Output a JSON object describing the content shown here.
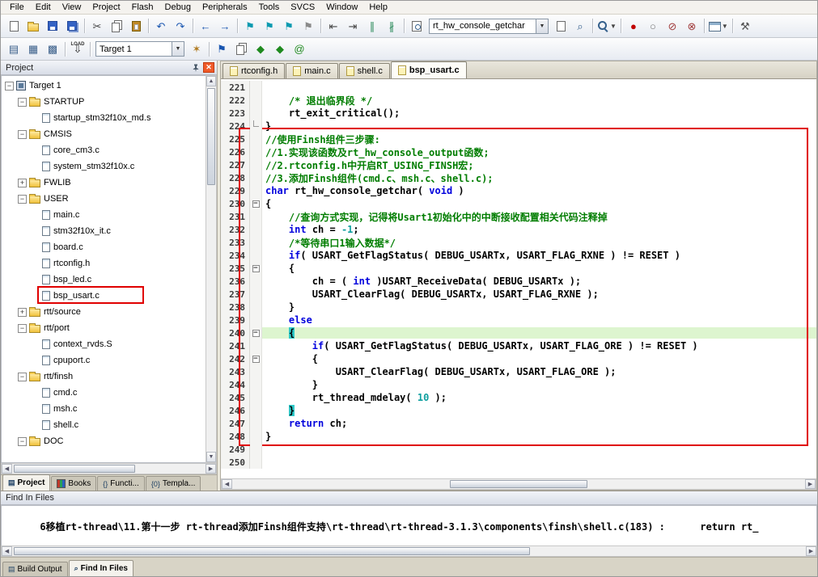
{
  "icons": {
    "dropdown": "▼",
    "minus": "−",
    "plus": "+",
    "fold_minus": "−",
    "scroll_up": "▲",
    "scroll_down": "▼",
    "scroll_left": "◀",
    "scroll_right": "▶"
  },
  "colors": {
    "annotation": "#e00000",
    "keyword": "#0000dd",
    "comment": "#007d00",
    "number": "#0f9f9f",
    "current_line": "#ddf5cf",
    "brace_match": "#2fc9c9"
  },
  "menu": {
    "items": [
      "File",
      "Edit",
      "View",
      "Project",
      "Flash",
      "Debug",
      "Peripherals",
      "Tools",
      "SVCS",
      "Window",
      "Help"
    ]
  },
  "toolbar1": {
    "items": [
      {
        "t": "b",
        "name": "new-file-button",
        "icon": "new-file-icon",
        "css": "pg"
      },
      {
        "t": "b",
        "name": "open-file-button",
        "icon": "open-folder-icon",
        "css": "fld"
      },
      {
        "t": "b",
        "name": "save-button",
        "icon": "save-icon",
        "css": "fl"
      },
      {
        "t": "b",
        "name": "save-all-button",
        "icon": "save-all-icon",
        "css": "fl2"
      },
      {
        "t": "s"
      },
      {
        "t": "b",
        "name": "cut-button",
        "icon": "scissors-icon",
        "glyph": "✂",
        "color": "#444"
      },
      {
        "t": "b",
        "name": "copy-button",
        "icon": "copy-icon",
        "css": "copy"
      },
      {
        "t": "b",
        "name": "paste-button",
        "icon": "paste-icon",
        "css": "paste"
      },
      {
        "t": "s"
      },
      {
        "t": "b",
        "name": "undo-button",
        "icon": "undo-icon",
        "glyph": "↶",
        "color": "#1a56b0"
      },
      {
        "t": "b",
        "name": "redo-button",
        "icon": "redo-icon",
        "glyph": "↷",
        "color": "#1a56b0"
      },
      {
        "t": "s"
      },
      {
        "t": "b",
        "name": "navigate-back-button",
        "icon": "arrow-left-icon",
        "glyph": "←",
        "color": "#1a56b0"
      },
      {
        "t": "b",
        "name": "navigate-forward-button",
        "icon": "arrow-right-icon",
        "glyph": "→",
        "color": "#1a56b0"
      },
      {
        "t": "s"
      },
      {
        "t": "b",
        "name": "toggle-bookmark-button",
        "icon": "bookmark-icon",
        "glyph": "⚑",
        "color": "#0a9ab0"
      },
      {
        "t": "b",
        "name": "prev-bookmark-button",
        "icon": "bookmark-prev-icon",
        "glyph": "⚑",
        "color": "#0a9ab0"
      },
      {
        "t": "b",
        "name": "next-bookmark-button",
        "icon": "bookmark-next-icon",
        "glyph": "⚑",
        "color": "#0a9ab0"
      },
      {
        "t": "b",
        "name": "clear-bookmarks-button",
        "icon": "bookmark-clear-icon",
        "glyph": "⚑",
        "color": "#8a8a8a"
      },
      {
        "t": "s"
      },
      {
        "t": "b",
        "name": "unindent-button",
        "icon": "unindent-icon",
        "glyph": "⇤",
        "color": "#444"
      },
      {
        "t": "b",
        "name": "indent-button",
        "icon": "indent-icon",
        "glyph": "⇥",
        "color": "#444"
      },
      {
        "t": "b",
        "name": "comment-button",
        "icon": "comment-icon",
        "glyph": "∥",
        "color": "#2a8a5a"
      },
      {
        "t": "b",
        "name": "uncomment-button",
        "icon": "uncomment-icon",
        "glyph": "∦",
        "color": "#2a8a5a"
      },
      {
        "t": "s"
      },
      {
        "t": "b",
        "name": "find-in-files-toolbar-button",
        "icon": "page-search-icon",
        "css": "pgm"
      },
      {
        "t": "c",
        "name": "find-text-combo",
        "value": "rt_hw_console_getchar",
        "w": 148
      },
      {
        "t": "b",
        "name": "search-files-button",
        "icon": "page-arrow-icon",
        "css": "pg"
      },
      {
        "t": "b",
        "name": "incremental-find-button",
        "icon": "binoculars-icon",
        "glyph": "⌕",
        "color": "#35608c"
      },
      {
        "t": "s"
      },
      {
        "t": "b",
        "name": "find-button",
        "icon": "magnifier-icon",
        "css": "mag",
        "dd": true
      },
      {
        "t": "s"
      },
      {
        "t": "b",
        "name": "insert-breakpoint-button",
        "icon": "breakpoint-icon",
        "glyph": "●",
        "color": "#c00000"
      },
      {
        "t": "b",
        "name": "enable-breakpoint-button",
        "icon": "breakpoint-enable-icon",
        "glyph": "○",
        "color": "#777777"
      },
      {
        "t": "b",
        "name": "disable-all-breakpoints-button",
        "icon": "breakpoint-disable-icon",
        "glyph": "⊘",
        "color": "#a03a3a"
      },
      {
        "t": "b",
        "name": "kill-all-breakpoints-button",
        "icon": "breakpoint-kill-icon",
        "glyph": "⊗",
        "color": "#a03a3a"
      },
      {
        "t": "s"
      },
      {
        "t": "b",
        "name": "debug-windows-button",
        "icon": "window-layout-icon",
        "css": "win",
        "dd": true
      },
      {
        "t": "s"
      },
      {
        "t": "b",
        "name": "configure-button",
        "icon": "wrench-icon",
        "glyph": "⚒",
        "color": "#555555"
      }
    ]
  },
  "toolbar2": {
    "items": [
      {
        "t": "b",
        "name": "translate-file-button",
        "icon": "translate-icon",
        "glyph": "▤",
        "color": "#3a5f8a"
      },
      {
        "t": "b",
        "name": "build-button",
        "icon": "build-icon",
        "glyph": "▦",
        "color": "#3a5f8a"
      },
      {
        "t": "b",
        "name": "rebuild-all-button",
        "icon": "rebuild-icon",
        "glyph": "▩",
        "color": "#3a5f8a"
      },
      {
        "t": "s"
      },
      {
        "t": "b",
        "name": "download-button",
        "icon": "download-icon",
        "glyph": "⇩",
        "color": "#333333",
        "label": "LOAD"
      },
      {
        "t": "s"
      },
      {
        "t": "c",
        "name": "target-select-combo",
        "value": "Target 1",
        "w": 110
      },
      {
        "t": "b",
        "name": "options-for-target-button",
        "icon": "magic-wand-icon",
        "glyph": "✶",
        "color": "#b07a20"
      },
      {
        "t": "s"
      },
      {
        "t": "b",
        "name": "file-extensions-button",
        "icon": "flag-icon",
        "glyph": "⚑",
        "color": "#1a56b0"
      },
      {
        "t": "b",
        "name": "manage-project-items-button",
        "icon": "stack-icon",
        "css": "copy"
      },
      {
        "t": "b",
        "name": "prev-item-button",
        "icon": "diamond-left-icon",
        "glyph": "◆",
        "color": "#1f8a1f"
      },
      {
        "t": "b",
        "name": "next-item-button",
        "icon": "diamond-right-icon",
        "glyph": "◆",
        "color": "#1f8a1f"
      },
      {
        "t": "b",
        "name": "pack-installer-button",
        "icon": "spiral-icon",
        "glyph": "@",
        "color": "#1f8a1f"
      }
    ]
  },
  "project_panel": {
    "title": "Project",
    "tree": [
      {
        "depth": 0,
        "expander": "minus",
        "icon": "target",
        "label": "Target 1"
      },
      {
        "depth": 1,
        "expander": "minus",
        "icon": "folder",
        "label": "STARTUP"
      },
      {
        "depth": 2,
        "icon": "file",
        "label": "startup_stm32f10x_md.s"
      },
      {
        "depth": 1,
        "expander": "minus",
        "icon": "folder",
        "label": "CMSIS"
      },
      {
        "depth": 2,
        "icon": "file",
        "label": "core_cm3.c"
      },
      {
        "depth": 2,
        "icon": "file",
        "label": "system_stm32f10x.c"
      },
      {
        "depth": 1,
        "expander": "plus",
        "icon": "folder",
        "label": "FWLIB"
      },
      {
        "depth": 1,
        "expander": "minus",
        "icon": "folder",
        "label": "USER"
      },
      {
        "depth": 2,
        "icon": "file",
        "label": "main.c"
      },
      {
        "depth": 2,
        "icon": "file",
        "label": "stm32f10x_it.c"
      },
      {
        "depth": 2,
        "icon": "file",
        "label": "board.c"
      },
      {
        "depth": 2,
        "icon": "file",
        "label": "rtconfig.h"
      },
      {
        "depth": 2,
        "icon": "file",
        "label": "bsp_led.c"
      },
      {
        "depth": 2,
        "icon": "file",
        "label": "bsp_usart.c",
        "annotated": true
      },
      {
        "depth": 1,
        "expander": "plus",
        "icon": "folder",
        "label": "rtt/source"
      },
      {
        "depth": 1,
        "expander": "minus",
        "icon": "folder",
        "label": "rtt/port"
      },
      {
        "depth": 2,
        "icon": "file",
        "label": "context_rvds.S"
      },
      {
        "depth": 2,
        "icon": "file",
        "label": "cpuport.c"
      },
      {
        "depth": 1,
        "expander": "minus",
        "icon": "folder",
        "label": "rtt/finsh"
      },
      {
        "depth": 2,
        "icon": "file",
        "label": "cmd.c"
      },
      {
        "depth": 2,
        "icon": "file",
        "label": "msh.c"
      },
      {
        "depth": 2,
        "icon": "file",
        "label": "shell.c"
      },
      {
        "depth": 1,
        "expander": "minus",
        "icon": "folder",
        "label": "DOC"
      }
    ],
    "tabs": [
      {
        "label": "Project",
        "icon": "project-tab-icon",
        "glyph": "▤",
        "active": true
      },
      {
        "label": "Books",
        "icon": "books-tab-icon",
        "glyph": "",
        "books": true,
        "active": false
      },
      {
        "label": "Functi...",
        "icon": "functions-tab-icon",
        "glyph": "{}",
        "active": false
      },
      {
        "label": "Templa...",
        "icon": "templates-tab-icon",
        "glyph": "{0}",
        "active": false
      }
    ]
  },
  "editor": {
    "tabs": [
      {
        "label": "rtconfig.h",
        "active": false
      },
      {
        "label": "main.c",
        "active": false
      },
      {
        "label": "shell.c",
        "active": false
      },
      {
        "label": "bsp_usart.c",
        "active": true
      }
    ],
    "lines": [
      {
        "n": 221,
        "tk": []
      },
      {
        "n": 222,
        "tk": [
          [
            "c",
            "    /* 退出临界段 */"
          ]
        ]
      },
      {
        "n": 223,
        "tk": [
          [
            "t",
            "    rt_exit_critical();"
          ]
        ]
      },
      {
        "n": 224,
        "fold": "e",
        "tk": [
          [
            "t",
            "}"
          ]
        ]
      },
      {
        "n": 225,
        "tk": [
          [
            "c",
            "//使用Finsh组件三步骤:"
          ]
        ]
      },
      {
        "n": 226,
        "tk": [
          [
            "c",
            "//1.实现该函数及rt_hw_console_output函数;"
          ]
        ]
      },
      {
        "n": 227,
        "tk": [
          [
            "c",
            "//2.rtconfig.h中开启RT_USING_FINSH宏;"
          ]
        ]
      },
      {
        "n": 228,
        "tk": [
          [
            "c",
            "//3.添加Finsh组件(cmd.c、msh.c、shell.c);"
          ]
        ]
      },
      {
        "n": 229,
        "tk": [
          [
            "k",
            "char"
          ],
          [
            "t",
            " rt_hw_console_getchar( "
          ],
          [
            "k",
            "void"
          ],
          [
            "t",
            " )"
          ]
        ]
      },
      {
        "n": 230,
        "fold": "m",
        "tk": [
          [
            "t",
            "{"
          ]
        ]
      },
      {
        "n": 231,
        "tk": [
          [
            "c",
            "    //查询方式实现，记得将Usart1初始化中的中断接收配置相关代码注释掉"
          ]
        ]
      },
      {
        "n": 232,
        "tk": [
          [
            "t",
            "    "
          ],
          [
            "k",
            "int"
          ],
          [
            "t",
            " ch = "
          ],
          [
            "n2",
            "-1"
          ],
          [
            "t",
            ";"
          ]
        ]
      },
      {
        "n": 233,
        "tk": [
          [
            "c",
            "    /*等待串口1输入数据*/"
          ]
        ]
      },
      {
        "n": 234,
        "tk": [
          [
            "t",
            "    "
          ],
          [
            "k",
            "if"
          ],
          [
            "t",
            "( USART_GetFlagStatus( DEBUG_USARTx, USART_FLAG_RXNE ) != RESET )"
          ]
        ]
      },
      {
        "n": 235,
        "fold": "m",
        "tk": [
          [
            "t",
            "    {"
          ]
        ]
      },
      {
        "n": 236,
        "tk": [
          [
            "t",
            "        ch = ( "
          ],
          [
            "k",
            "int"
          ],
          [
            "t",
            " )USART_ReceiveData( DEBUG_USARTx );"
          ]
        ]
      },
      {
        "n": 237,
        "tk": [
          [
            "t",
            "        USART_ClearFlag( DEBUG_USARTx, USART_FLAG_RXNE );"
          ]
        ]
      },
      {
        "n": 238,
        "tk": [
          [
            "t",
            "    }"
          ]
        ]
      },
      {
        "n": 239,
        "tk": [
          [
            "t",
            "    "
          ],
          [
            "k",
            "else"
          ]
        ]
      },
      {
        "n": 240,
        "fold": "m",
        "hl": true,
        "tk": [
          [
            "t",
            "    "
          ],
          [
            "b",
            "{"
          ]
        ]
      },
      {
        "n": 241,
        "tk": [
          [
            "t",
            "        "
          ],
          [
            "k",
            "if"
          ],
          [
            "t",
            "( USART_GetFlagStatus( DEBUG_USARTx, USART_FLAG_ORE ) != RESET )"
          ]
        ]
      },
      {
        "n": 242,
        "fold": "m",
        "tk": [
          [
            "t",
            "        {"
          ]
        ]
      },
      {
        "n": 243,
        "tk": [
          [
            "t",
            "            USART_ClearFlag( DEBUG_USARTx, USART_FLAG_ORE );"
          ]
        ]
      },
      {
        "n": 244,
        "tk": [
          [
            "t",
            "        }"
          ]
        ]
      },
      {
        "n": 245,
        "tk": [
          [
            "t",
            "        rt_thread_mdelay( "
          ],
          [
            "n2",
            "10"
          ],
          [
            "t",
            " );"
          ]
        ]
      },
      {
        "n": 246,
        "tk": [
          [
            "t",
            "    "
          ],
          [
            "b",
            "}"
          ]
        ]
      },
      {
        "n": 247,
        "tk": [
          [
            "t",
            "    "
          ],
          [
            "k",
            "return"
          ],
          [
            "t",
            " ch;"
          ]
        ]
      },
      {
        "n": 248,
        "tk": [
          [
            "t",
            "}"
          ]
        ]
      },
      {
        "n": 249,
        "tk": []
      },
      {
        "n": 250,
        "tk": []
      }
    ]
  },
  "find_in_files": {
    "title": "Find In Files",
    "result_line": "6移植rt-thread\\11.第十一步 rt-thread添加Finsh组件支持\\rt-thread\\rt-thread-3.1.3\\components\\finsh\\shell.c(183) :      return rt_"
  },
  "bottom_tabs": [
    {
      "label": "Build Output",
      "icon": "build-output-tab-icon",
      "glyph": "▤",
      "active": false
    },
    {
      "label": "Find In Files",
      "icon": "find-in-files-tab-icon",
      "glyph": "⌕",
      "active": true
    }
  ]
}
